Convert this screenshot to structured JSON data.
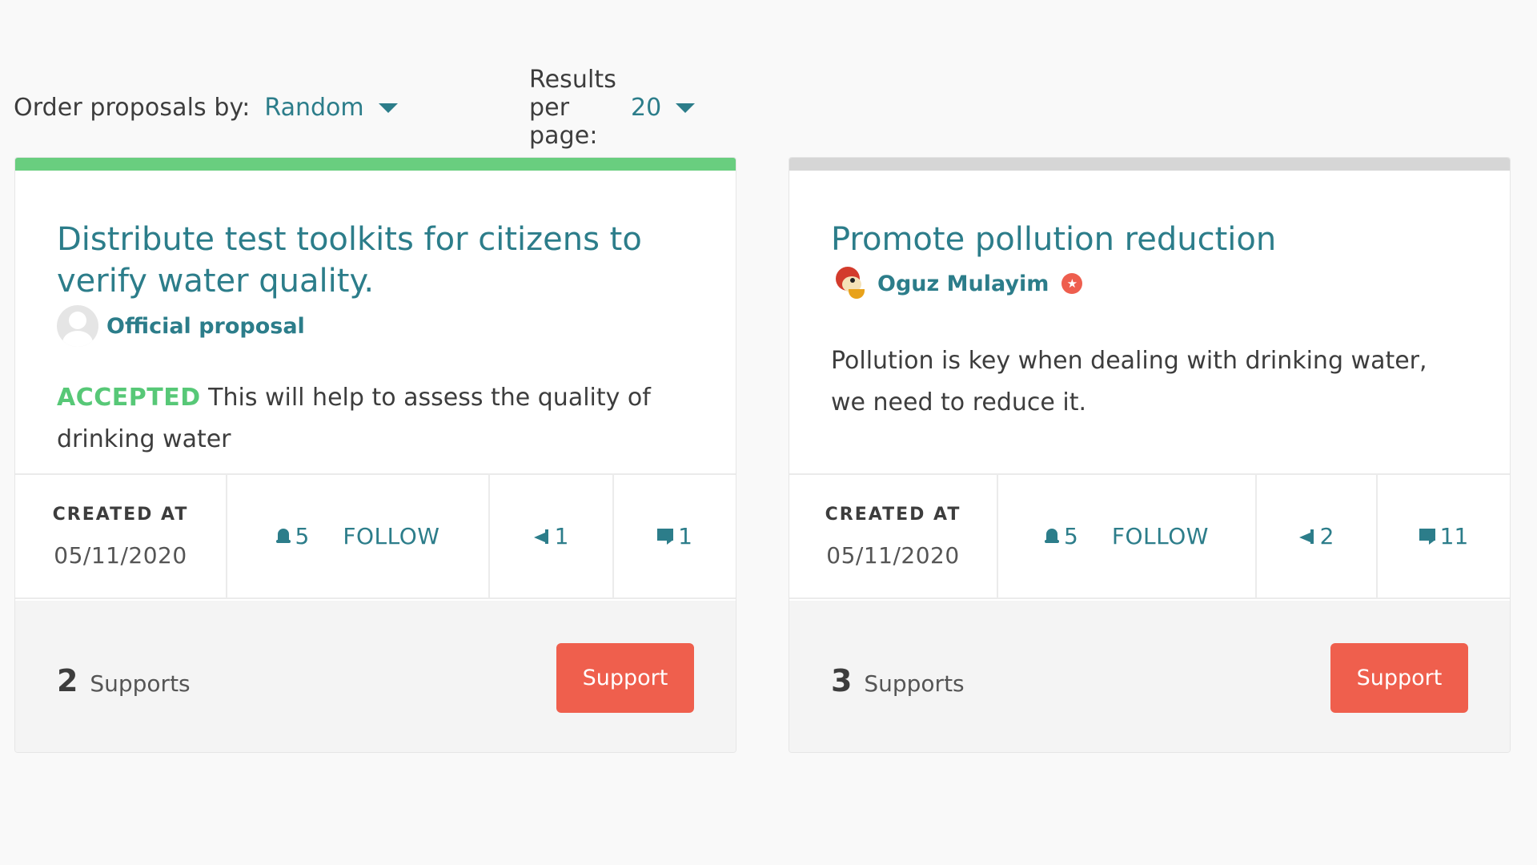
{
  "filters": {
    "order_label": "Order proposals by:",
    "order_value": "Random",
    "per_page_label": "Results per page:",
    "per_page_value": "20"
  },
  "colors": {
    "accent": "#2c7d8a",
    "accepted": "#57c877",
    "support_button": "#ef5f4d",
    "bar_accepted": "#69ce7f",
    "bar_neutral": "#d6d6d6"
  },
  "proposals": [
    {
      "title": "Distribute test toolkits for citizens to verify water quality.",
      "author": "Official proposal",
      "status": "ACCEPTED",
      "description": "This will help to assess the quality of drinking water",
      "created_label": "CREATED AT",
      "created_date": "05/11/2020",
      "followers": "5",
      "follow_label": "FOLLOW",
      "endorsements": "1",
      "comments": "1",
      "supports_count": "2",
      "supports_label": "Supports",
      "support_button": "Support"
    },
    {
      "title": "Promote pollution reduction",
      "author": "Oguz Mulayim",
      "status": "",
      "description": "Pollution is key when dealing with drinking water, we need to reduce it.",
      "created_label": "CREATED AT",
      "created_date": "05/11/2020",
      "followers": "5",
      "follow_label": "FOLLOW",
      "endorsements": "2",
      "comments": "11",
      "supports_count": "3",
      "supports_label": "Supports",
      "support_button": "Support"
    }
  ]
}
